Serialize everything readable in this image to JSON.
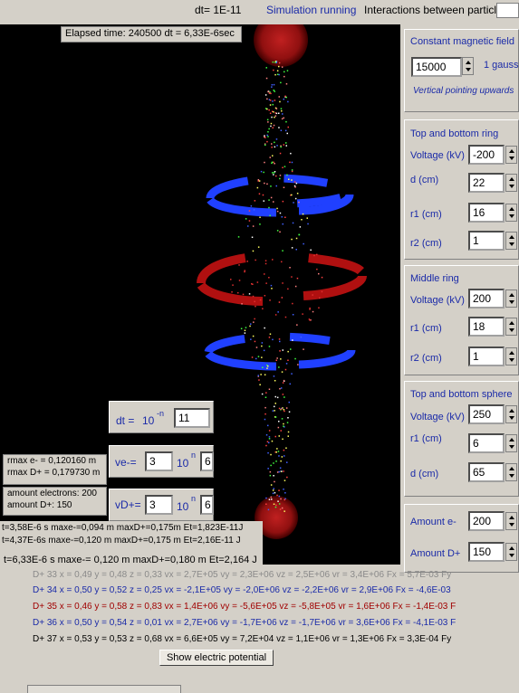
{
  "topbar": {
    "dt_label": "dt= 1E-11",
    "status": "Simulation running",
    "interactions_label": "Interactions between particles"
  },
  "elapsed": "Elapsed time: 240500 dt   = 6,33E-6sec",
  "magnetic": {
    "title": "Constant magnetic field",
    "value": "15000",
    "unit": "1 gauss",
    "note": "Vertical pointing upwards"
  },
  "top_bottom_ring": {
    "title": "Top and bottom ring",
    "voltage_label": "Voltage (kV)",
    "voltage": "-200",
    "d_label": "d (cm)",
    "d": "22",
    "r1_label": "r1 (cm)",
    "r1": "16",
    "r2_label": "r2 (cm)",
    "r2": "1"
  },
  "middle_ring": {
    "title": "Middle ring",
    "voltage_label": "Voltage (kV)",
    "voltage": "200",
    "r1_label": "r1 (cm)",
    "r1": "18",
    "r2_label": "r2 (cm)",
    "r2": "1"
  },
  "sphere": {
    "title": "Top and bottom sphere",
    "voltage_label": "Voltage (kV)",
    "voltage": "250",
    "r1_label": "r1 (cm)",
    "r1": "6",
    "d_label": "d (cm)",
    "d": "65"
  },
  "amounts": {
    "e_label": "Amount e-",
    "e_value": "200",
    "d_label": "Amount D+",
    "d_value": "150"
  },
  "dt_box": {
    "label": "dt =",
    "base": "10",
    "exp": "-n",
    "value": "11"
  },
  "ve_box": {
    "label": "ve-=",
    "mant": "3",
    "base": "10",
    "exp": "n",
    "value": "6"
  },
  "vd_box": {
    "label": "vD+=",
    "mant": "3",
    "base": "10",
    "exp": "n",
    "value": "6"
  },
  "rmax": {
    "e": "rmax e-  = 0,120160 m",
    "d": "rmax D+ = 0,179730 m"
  },
  "amount_info": {
    "e": "amount electrons: 200",
    "d": "amount D+: 150"
  },
  "log": [
    "t=3,58E-6 s  maxe-=0,094 m maxD+=0,175m Et=1,823E-11J",
    "t=4,37E-6s maxe-=0,120 m maxD+=0,175 m Et=2,16E-11 J",
    "t=6,33E-6 s maxe-= 0,120 m maxD+=0,180 m Et=2,164 J"
  ],
  "particles": [
    {
      "c": "#8a8a8a",
      "text": "D+ 33    x = 0,49    y = 0,48   z = 0,33   vx = 2,7E+05     vy = 2,3E+06   vz = 2,5E+06   vr = 3,4E+06  Fx = 5,7E-03   Fy"
    },
    {
      "c": "#1a2aa8",
      "text": "D+ 34    x = 0,50    y = 0,52   z = 0,25   vx = -2,1E+05    vy = -2,0E+06  vz = -2,2E+06  vr = 2,9E+06  Fx = -4,6E-03"
    },
    {
      "c": "#a00000",
      "text": "D+ 35    x = 0,46    y = 0,58   z = 0,83   vx = 1,4E+06     vy = -5,6E+05  vz = -5,8E+05  vr = 1,6E+06  Fx = -1,4E-03   F"
    },
    {
      "c": "#1a2aa8",
      "text": "D+ 36    x = 0,50    y = 0,54   z = 0,01   vx = 2,7E+06     vy = -1,7E+06  vz = -1,7E+06  vr = 3,6E+06  Fx = -4,1E-03   F"
    },
    {
      "c": "#000000",
      "text": "D+ 37    x = 0,53    y = 0,53   z = 0,68   vx = 6,6E+05     vy = 7,2E+04   vz = 1,1E+06   vr = 1,3E+06  Fx = 3,3E-04   Fy"
    }
  ],
  "show_button": "Show electric potential"
}
